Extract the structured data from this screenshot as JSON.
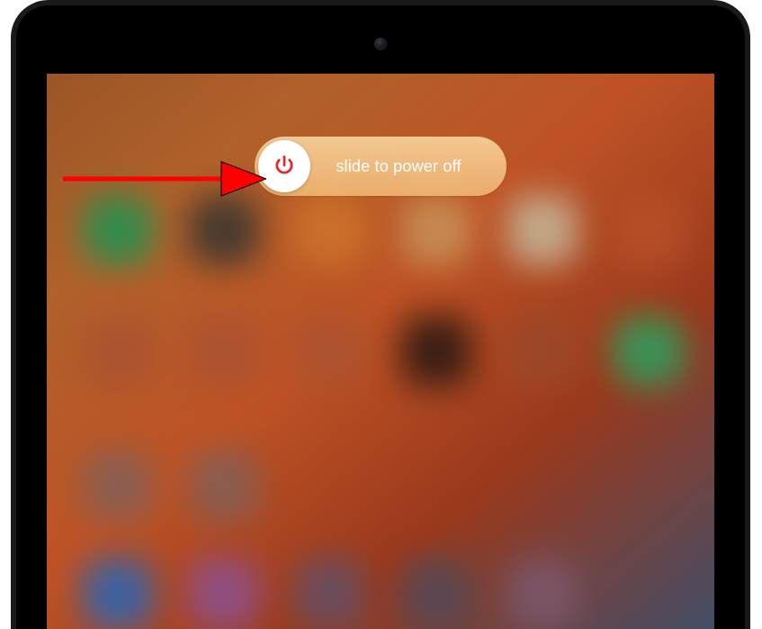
{
  "slider": {
    "label": "slide to power off",
    "icon_name": "power-icon",
    "icon_color": "#e22b2b",
    "knob_color": "#ffffff"
  },
  "annotation": {
    "arrow_color": "#ff0000"
  }
}
